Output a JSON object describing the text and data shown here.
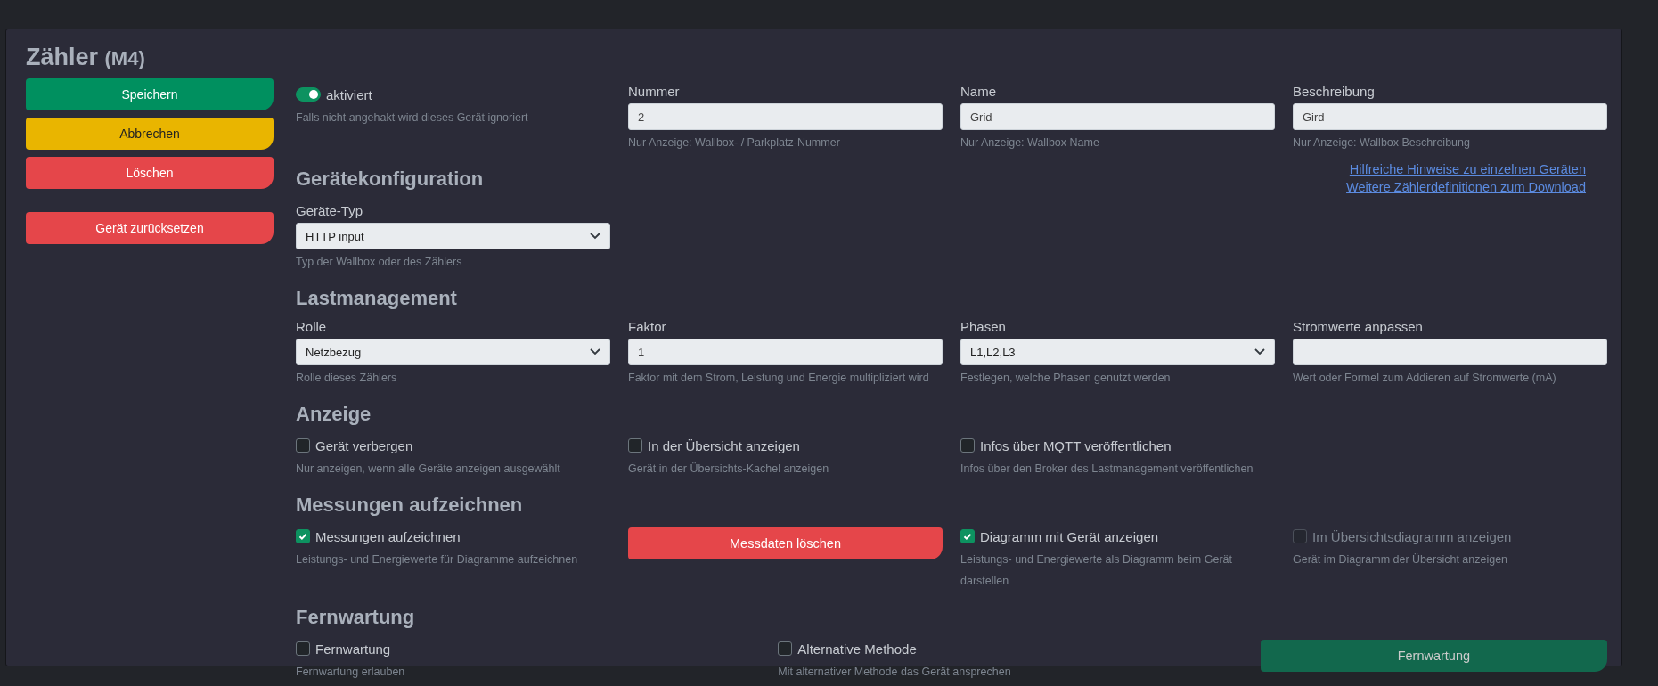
{
  "title": "Zähler",
  "subtitle": "(M4)",
  "actions": [
    {
      "label": "Speichern",
      "kind": "save"
    },
    {
      "label": "Abbrechen",
      "kind": "cancel"
    },
    {
      "label": "Löschen",
      "kind": "delete"
    },
    {
      "label": "Gerät zurücksetzen",
      "kind": "reset"
    }
  ],
  "sections": [
    {
      "kind": "grid",
      "items": [
        {
          "kind": "switch",
          "label": "aktiviert",
          "on": true,
          "hint": "Falls nicht angehakt wird dieses Gerät ignoriert"
        },
        {
          "kind": "text",
          "label": "Nummer",
          "value": "2",
          "hint": "Nur Anzeige: Wallbox- / Parkplatz-Nummer"
        },
        {
          "kind": "text",
          "label": "Name",
          "value": "Grid",
          "hint": "Nur Anzeige: Wallbox Name"
        },
        {
          "kind": "text",
          "label": "Beschreibung",
          "value": "Gird",
          "hint": "Nur Anzeige: Wallbox Beschreibung"
        }
      ]
    },
    {
      "kind": "grid",
      "title": "Gerätekonfiguration",
      "links": [
        "Hilfreiche Hinweise zu einzelnen Geräten",
        "Weitere Zählerdefinitionen zum Download"
      ],
      "items": [
        {
          "kind": "select",
          "label": "Geräte-Typ",
          "value": "HTTP input",
          "hint": "Typ der Wallbox oder des Zählers"
        }
      ]
    },
    {
      "kind": "grid",
      "title": "Lastmanagement",
      "items": [
        {
          "kind": "select",
          "label": "Rolle",
          "value": "Netzbezug",
          "hint": "Rolle dieses Zählers"
        },
        {
          "kind": "text",
          "label": "Faktor",
          "value": "1",
          "hint": "Faktor mit dem Strom, Leistung und Energie multipliziert wird"
        },
        {
          "kind": "select",
          "label": "Phasen",
          "value": "L1,L2,L3",
          "hint": "Festlegen, welche Phasen genutzt werden"
        },
        {
          "kind": "text",
          "label": "Stromwerte anpassen",
          "hint": "Wert oder Formel zum Addieren auf Stromwerte (mA)"
        }
      ]
    },
    {
      "kind": "grid",
      "title": "Anzeige",
      "items": [
        {
          "kind": "checkbox",
          "label": "Gerät verbergen",
          "checked": false,
          "disabled": false,
          "hint": "Nur anzeigen, wenn alle Geräte anzeigen ausgewählt"
        },
        {
          "kind": "checkbox",
          "label": "In der Übersicht anzeigen",
          "checked": false,
          "disabled": false,
          "hint": "Gerät in der Übersichts-Kachel anzeigen"
        },
        {
          "kind": "checkbox",
          "label": "Infos über MQTT veröffentlichen",
          "checked": false,
          "disabled": false,
          "hint": "Infos über den Broker des Lastmanagement veröffentlichen"
        }
      ]
    },
    {
      "kind": "grid",
      "title": "Messungen aufzeichnen",
      "items": [
        {
          "kind": "checkbox",
          "label": "Messungen aufzeichnen",
          "checked": true,
          "disabled": false,
          "hint": "Leistungs- und Energiewerte für Diagramme aufzeichnen"
        },
        {
          "kind": "danger",
          "label": "Messdaten löschen"
        },
        {
          "kind": "checkbox",
          "label": "Diagramm mit Gerät anzeigen",
          "checked": true,
          "disabled": false,
          "hint": "Leistungs- und Energiewerte als Diagramm beim Gerät darstellen"
        },
        {
          "kind": "checkbox",
          "label": "Im Übersichtsdiagramm anzeigen",
          "checked": false,
          "disabled": true,
          "hint": "Gerät im Diagramm der Übersicht anzeigen"
        }
      ]
    },
    {
      "kind": "thirds",
      "title": "Fernwartung",
      "items": [
        {
          "kind": "checkbox",
          "label": "Fernwartung",
          "checked": false,
          "disabled": false,
          "hint": "Fernwartung erlauben"
        },
        {
          "kind": "checkbox",
          "label": "Alternative Methode",
          "checked": false,
          "disabled": false,
          "hint": "Mit alternativer Methode das Gerät ansprechen"
        },
        {
          "kind": "remote",
          "label": "Fernwartung"
        }
      ]
    }
  ]
}
